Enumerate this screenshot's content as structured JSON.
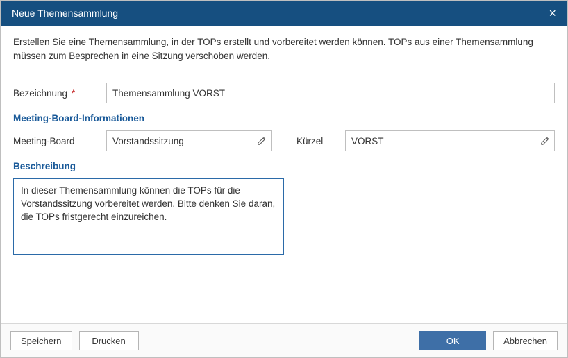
{
  "titlebar": {
    "title": "Neue Themensammlung"
  },
  "intro": "Erstellen Sie eine Themensammlung, in der TOPs erstellt und vorbereitet werden können. TOPs aus einer Themensammlung müssen zum Besprechen in eine Sitzung verschoben werden.",
  "labels": {
    "bezeichnung": "Bezeichnung",
    "meetingBoardSection": "Meeting-Board-Informationen",
    "meetingBoard": "Meeting-Board",
    "kuerzel": "Kürzel",
    "beschreibung": "Beschreibung"
  },
  "fields": {
    "bezeichnung": "Themensammlung VORST",
    "meetingBoard": "Vorstandssitzung",
    "kuerzel": "VORST",
    "beschreibung": "In dieser Themensammlung können die TOPs für die Vorstandssitzung vorbereitet werden. Bitte denken Sie daran, die TOPs fristgerecht einzureichen."
  },
  "buttons": {
    "speichern": "Speichern",
    "drucken": "Drucken",
    "ok": "OK",
    "abbrechen": "Abbrechen"
  },
  "icons": {
    "close": "×"
  }
}
